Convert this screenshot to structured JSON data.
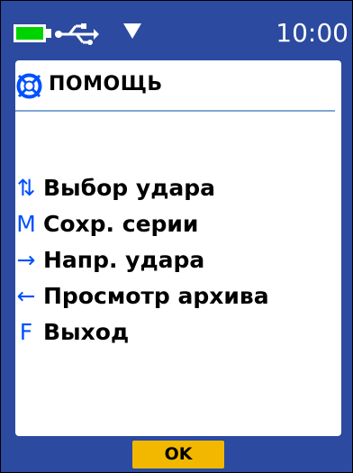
{
  "statusbar": {
    "battery_icon": "battery-full-icon",
    "usb_icon": "usb-icon",
    "signal_icon": "down-triangle-icon",
    "time": "10:00",
    "battery_color": "#00d400"
  },
  "help": {
    "icon": "lifebuoy-icon",
    "title": "ПОМОЩЬ",
    "items": [
      {
        "key": "⇅",
        "key_icon": "up-down-arrows-icon",
        "label": "Выбор удара"
      },
      {
        "key": "M",
        "label": "Сохр. серии"
      },
      {
        "key": "→",
        "key_icon": "right-arrow-icon",
        "label": "Напр. удара"
      },
      {
        "key": "←",
        "key_icon": "left-arrow-icon",
        "label": "Просмотр архива"
      },
      {
        "key": "F",
        "label": "Выход"
      }
    ]
  },
  "softkeys": {
    "ok_label": "OK"
  },
  "colors": {
    "frame": "#2b4aa0",
    "panel": "#ffffff",
    "key_glyph": "#0050ff",
    "title_rule": "#7fa7d2",
    "ok_button": "#f2b800"
  }
}
